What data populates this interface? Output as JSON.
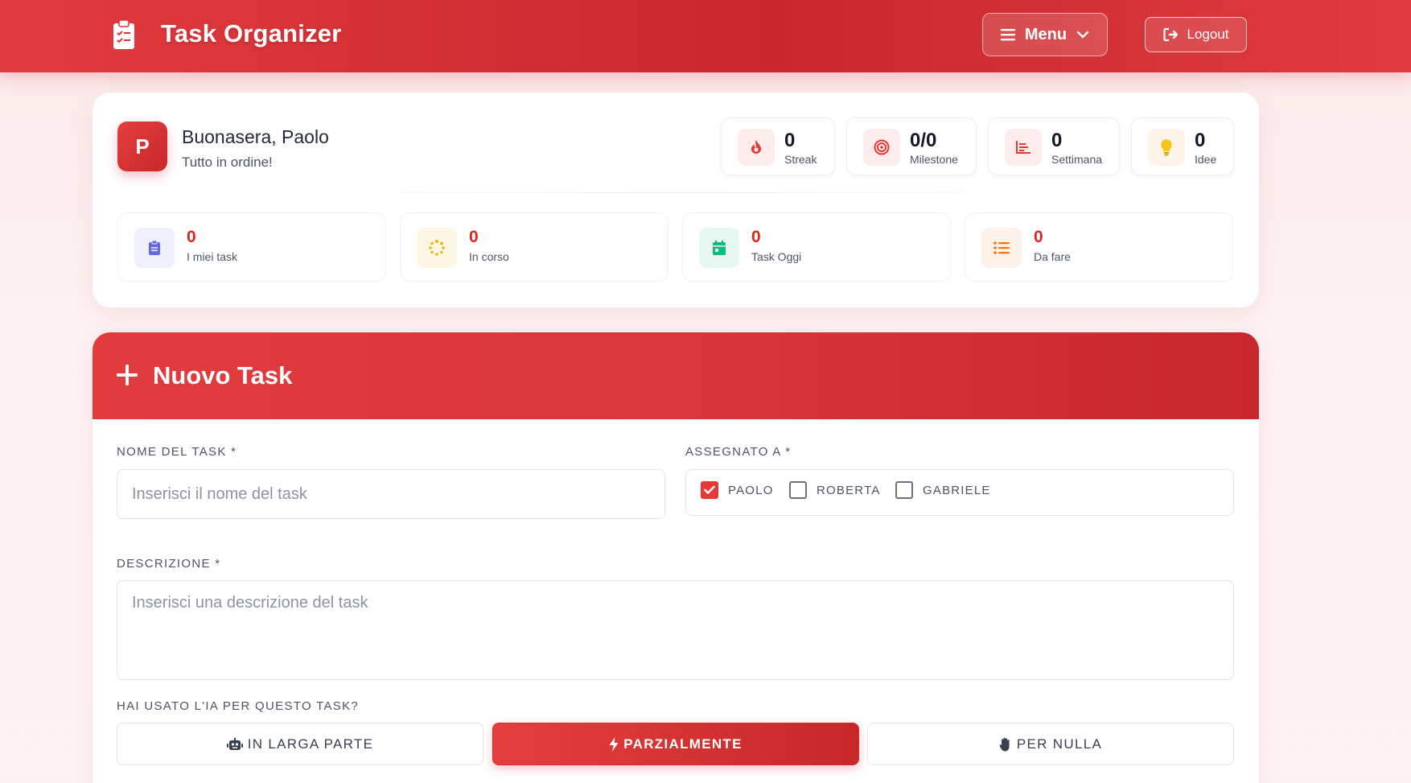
{
  "header": {
    "title": "Task Organizer",
    "menu_label": "Menu",
    "logout_label": "Logout"
  },
  "user": {
    "initial": "P",
    "greeting": "Buonasera, Paolo",
    "status": "Tutto in ordine!"
  },
  "stat_chips": [
    {
      "value": "0",
      "label": "Streak",
      "icon": "fire-icon"
    },
    {
      "value": "0/0",
      "label": "Milestone",
      "icon": "target-icon"
    },
    {
      "value": "0",
      "label": "Settimana",
      "icon": "chart-icon"
    },
    {
      "value": "0",
      "label": "Idee",
      "icon": "lightbulb-icon"
    }
  ],
  "task_stats": [
    {
      "value": "0",
      "label": "I miei task",
      "icon": "clipboard-icon",
      "color": "#6366f1"
    },
    {
      "value": "0",
      "label": "In corso",
      "icon": "spinner-icon",
      "color": "#eab308"
    },
    {
      "value": "0",
      "label": "Task Oggi",
      "icon": "calendar-icon",
      "color": "#10b981"
    },
    {
      "value": "0",
      "label": "Da fare",
      "icon": "list-icon",
      "color": "#f97316"
    }
  ],
  "new_task": {
    "title": "Nuovo Task",
    "name_label": "NOME DEL TASK *",
    "name_placeholder": "Inserisci il nome del task",
    "assign_label": "ASSEGNATO A *",
    "assignees": [
      {
        "name": "PAOLO",
        "checked": true
      },
      {
        "name": "ROBERTA",
        "checked": false
      },
      {
        "name": "GABRIELE",
        "checked": false
      }
    ],
    "desc_label": "DESCRIZIONE *",
    "desc_placeholder": "Inserisci una descrizione del task",
    "ai_label": "HAI USATO L'IA PER QUESTO TASK?",
    "ai_options": [
      {
        "label": "IN LARGA PARTE",
        "icon": "robot-icon",
        "selected": false
      },
      {
        "label": "PARZIALMENTE",
        "icon": "bolt-icon",
        "selected": true
      },
      {
        "label": "PER NULLA",
        "icon": "hand-icon",
        "selected": false
      }
    ]
  },
  "colors": {
    "primary": "#dc2626",
    "primary_dark": "#c62828"
  }
}
